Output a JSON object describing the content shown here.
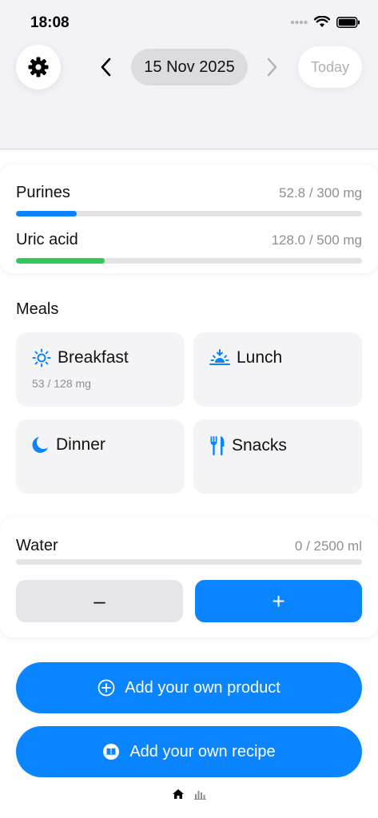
{
  "status_bar": {
    "time": "18:08"
  },
  "header": {
    "date_label": "15 Nov 2025",
    "today_label": "Today"
  },
  "summary": {
    "purines": {
      "label": "Purines",
      "value_text": "52.8 / 300 mg",
      "progress": 0.176,
      "color": "#0a84ff"
    },
    "uric_acid": {
      "label": "Uric acid",
      "value_text": "128.0 / 500 mg",
      "progress": 0.256,
      "color": "#34c759"
    }
  },
  "meals": {
    "title": "Meals",
    "items": [
      {
        "name": "Breakfast",
        "icon": "sun-icon",
        "detail": "53 / 128 mg"
      },
      {
        "name": "Lunch",
        "icon": "sunrise-icon",
        "detail": ""
      },
      {
        "name": "Dinner",
        "icon": "moon-icon",
        "detail": ""
      },
      {
        "name": "Snacks",
        "icon": "fork-knife-icon",
        "detail": ""
      }
    ]
  },
  "water": {
    "label": "Water",
    "value_text": "0 / 2500 ml",
    "progress": 0,
    "decrement_label": "–",
    "increment_label": "+"
  },
  "actions": {
    "add_product_label": "Add your own product",
    "add_recipe_label": "Add your own recipe"
  },
  "colors": {
    "accent": "#0a84ff",
    "green": "#34c759",
    "muted": "#8e8e93"
  }
}
